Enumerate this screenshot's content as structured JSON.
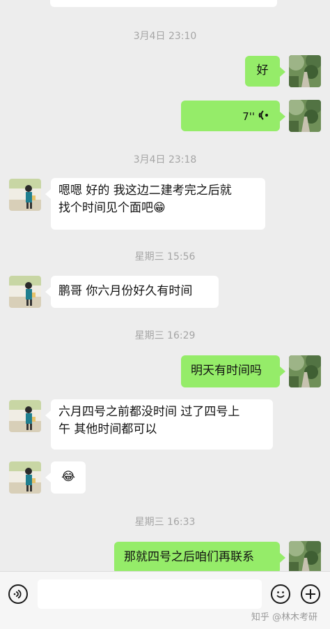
{
  "timestamps": [
    "3月4日 23:10",
    "3月4日 23:18",
    "星期三 15:56",
    "星期三 16:29",
    "星期三 16:33"
  ],
  "messages": {
    "m1": "好",
    "m2_duration": "7''",
    "m3_line1": "嗯嗯 好的  我这边二建考完之后就",
    "m3_line2": "找个时间见个面吧",
    "m4": "鹏哥 你六月份好久有时间",
    "m5": "明天有时间吗",
    "m6_line1": "六月四号之前都没时间 过了四号上",
    "m6_line2": "午 其他时间都可以",
    "m8": "那就四号之后咱们再联系"
  },
  "emoji": {
    "grin": "😁",
    "laugh_cry": "😂"
  },
  "input_bar": {
    "placeholder": ""
  },
  "watermark": "知乎 @林木考研",
  "icons": {
    "voice_toggle": "voice-icon",
    "emoji_btn": "emoji-icon",
    "plus_btn": "plus-icon"
  },
  "colors": {
    "background": "#ededed",
    "outgoing_bubble": "#95ec69",
    "incoming_bubble": "#ffffff",
    "timestamp": "#a5a5a5"
  }
}
